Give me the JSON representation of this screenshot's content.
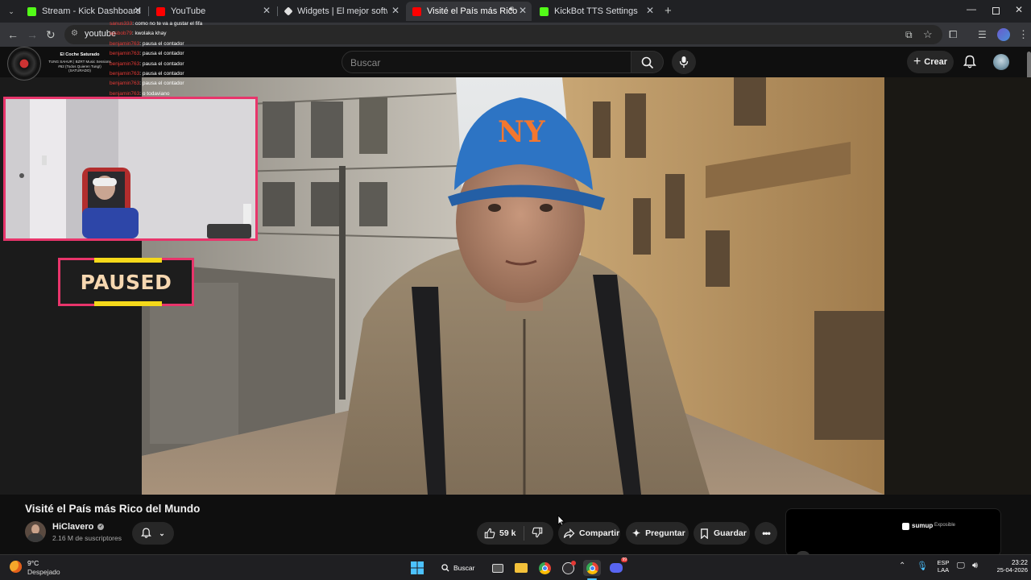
{
  "browser": {
    "tabs": [
      {
        "label": "Stream - Kick Dashboard",
        "icon": "kick-icon",
        "color": "#53fc18"
      },
      {
        "label": "YouTube",
        "icon": "youtube-icon",
        "color": "#ff0000"
      },
      {
        "label": "Widgets | El mejor software para",
        "icon": "widgets-icon",
        "color": "#e0e0e0"
      },
      {
        "label": "Visité el País más Rico del M",
        "icon": "youtube-icon",
        "color": "#ff0000",
        "active": true
      },
      {
        "label": "KickBot TTS Settings",
        "icon": "kick-icon",
        "color": "#53fc18"
      }
    ],
    "url": "youtube"
  },
  "stream_overlay": {
    "now_playing": {
      "title": "El Coche Saturado",
      "subtitle": "TUNG SAHUR | BZRT Music Sessions #62 (Todos Quieren Tung!) (SATURADO)"
    },
    "chat": [
      {
        "user": "sanus333",
        "msg": "como no te va a gustar el fifa"
      },
      {
        "user": "sysbob79",
        "msg": "kwolaka khay"
      },
      {
        "user": "benjamin763",
        "msg": "pausa el contador"
      },
      {
        "user": "benjamin763",
        "msg": "pausa el contador"
      },
      {
        "user": "benjamin763",
        "msg": "pausa el contador"
      },
      {
        "user": "benjamin763",
        "msg": "pausa el contador"
      },
      {
        "user": "benjamin763",
        "msg": "pausa el contador"
      },
      {
        "user": "benjamin763",
        "msg": "o todaviano"
      }
    ],
    "paused_label": "PAUSED"
  },
  "youtube": {
    "search_placeholder": "Buscar",
    "create_label": "Crear",
    "video_title": "Visité el País más Rico del Mundo",
    "channel_name": "HiClavero",
    "subscribers": "2.16 M de suscriptores",
    "likes": "59 k",
    "share_label": "Compartir",
    "ask_label": "Preguntar",
    "save_label": "Guardar",
    "ad_brand": "sumup",
    "ad_text": "Exposible"
  },
  "taskbar": {
    "weather_temp": "9°C",
    "weather_desc": "Despejado",
    "search_label": "Buscar",
    "lang_top": "ESP",
    "lang_bottom": "LAA",
    "time": "23:22",
    "date": "25-04-2026",
    "discord_badge": "99"
  },
  "colors": {
    "accent_pink": "#e8356b",
    "paused_yellow": "#f5d91a",
    "kick_green": "#53fc18",
    "youtube_red": "#ff0000"
  }
}
